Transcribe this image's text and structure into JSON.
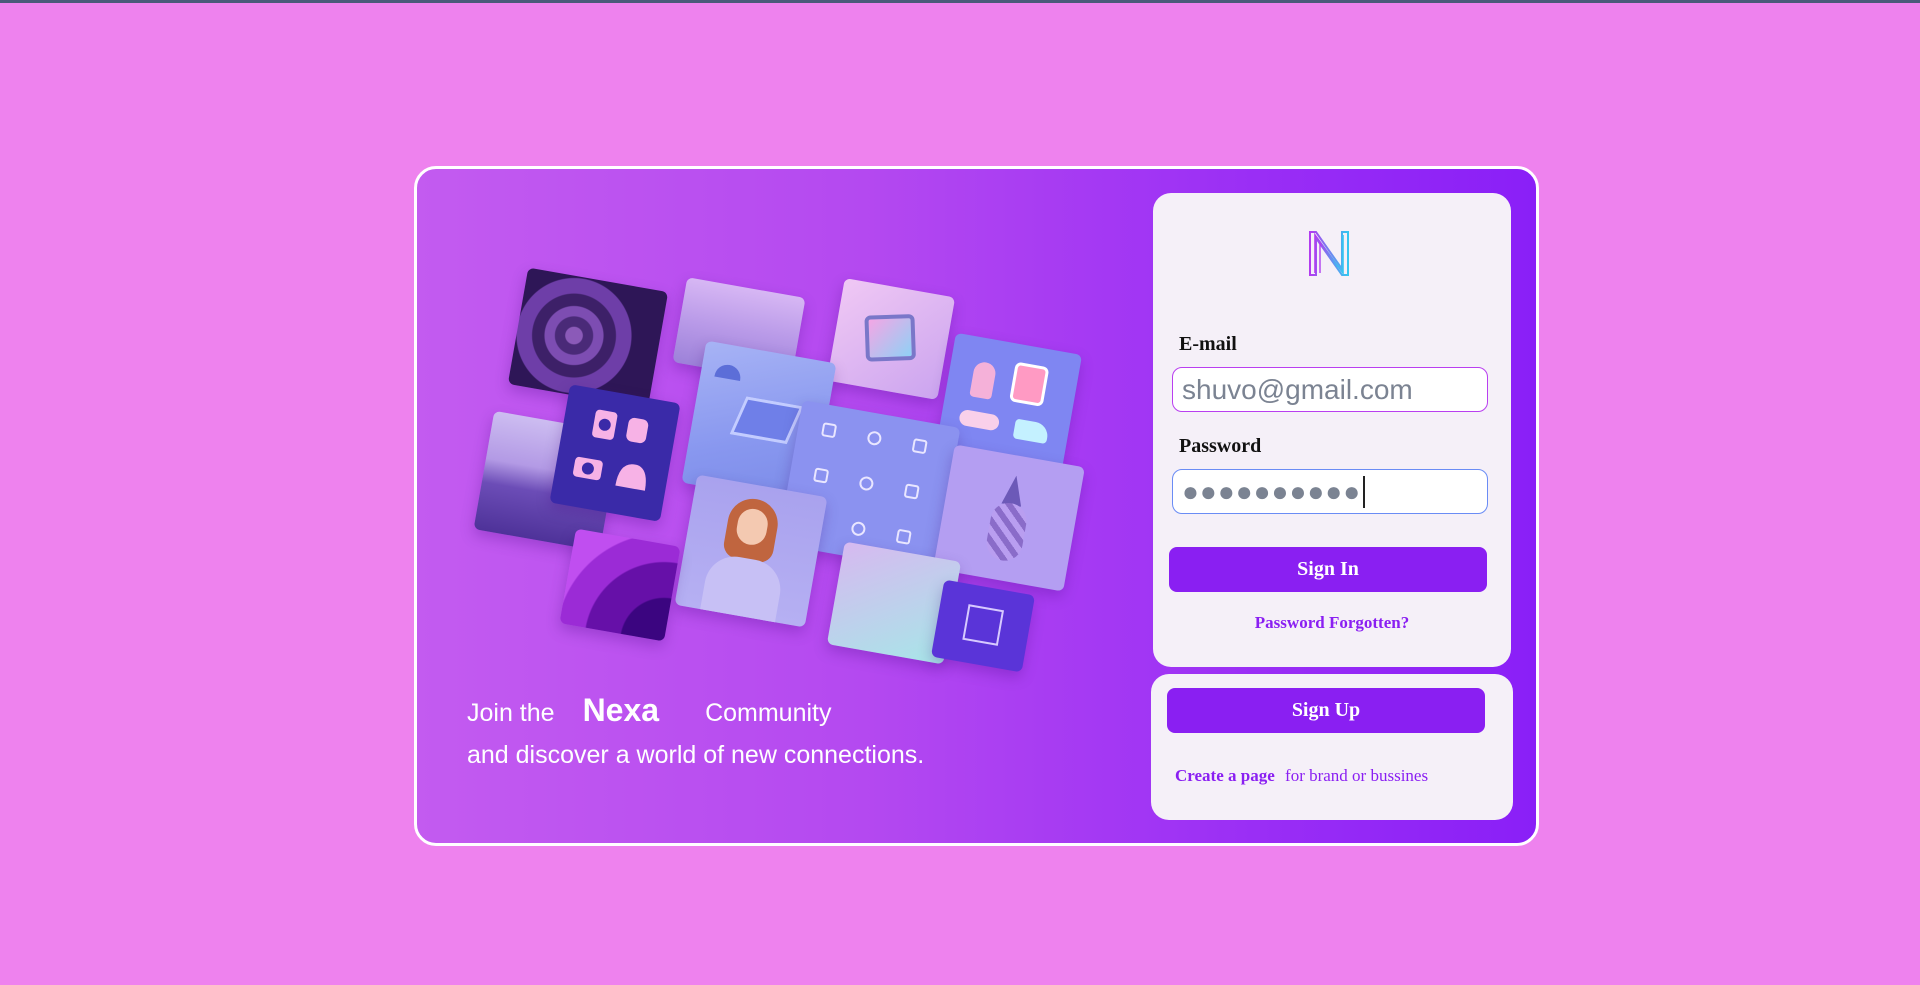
{
  "tagline": {
    "join": "Join the",
    "brand": "Nexa",
    "community": "Community",
    "line2": "and discover a world of new connections."
  },
  "login": {
    "logo_icon": "nexa-n-logo-icon",
    "email_label": "E-mail",
    "email_placeholder": "shuvo@gmail.com",
    "password_label": "Password",
    "password_value": "●●●●●●●●●●",
    "signin_label": "Sign In",
    "forgot_label": "Password Forgotten?"
  },
  "signup": {
    "signup_label": "Sign Up",
    "create_link": "Create a page",
    "create_suffix": "for brand or bussines"
  },
  "colors": {
    "page_background": "#ee82ee",
    "accent": "#8a1ff2",
    "panel": "#f5f0f8"
  }
}
